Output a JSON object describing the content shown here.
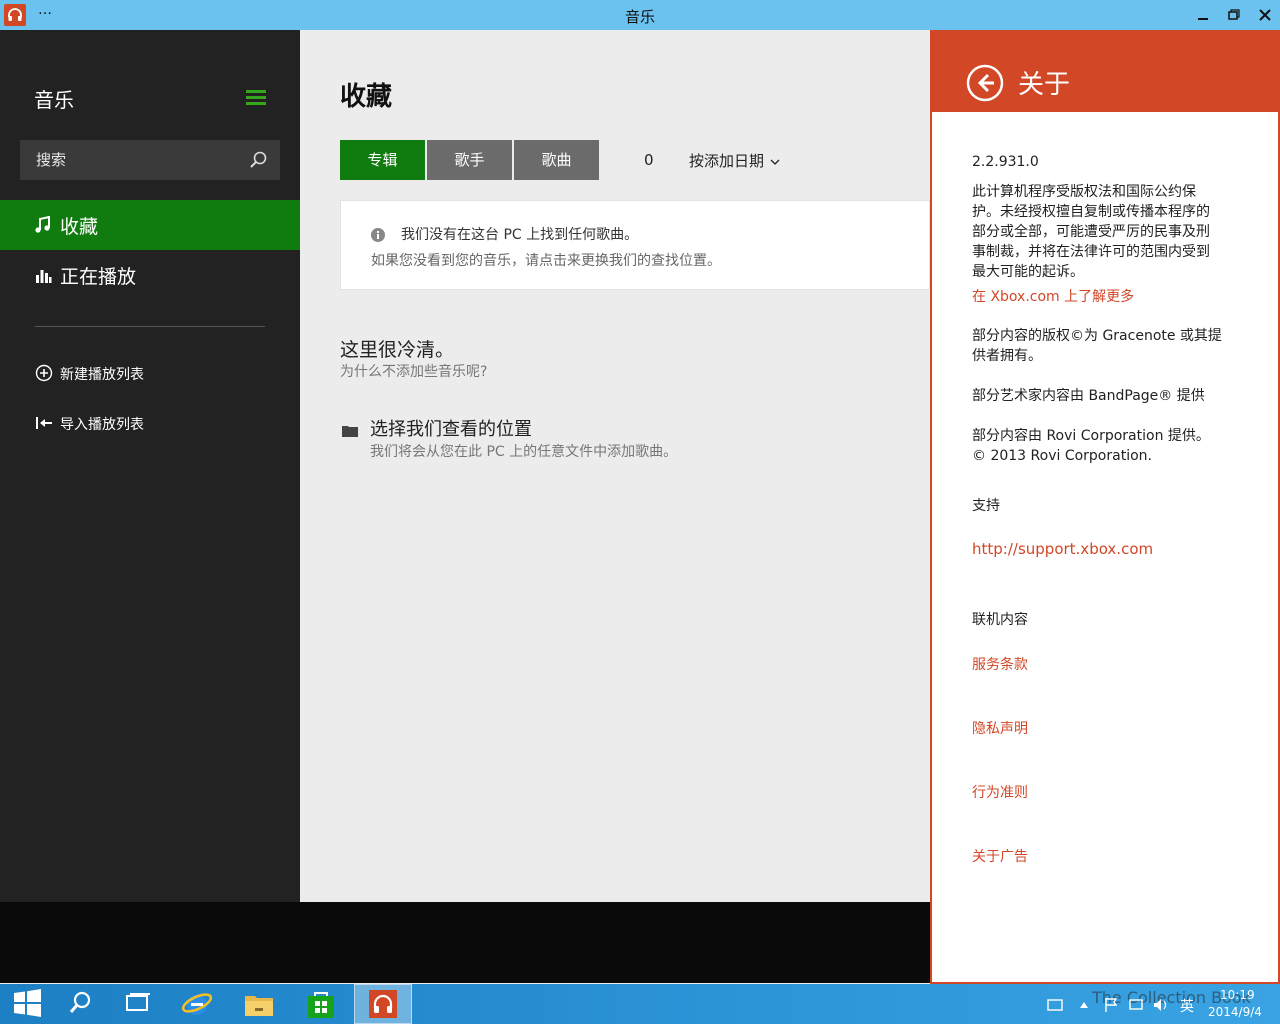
{
  "window": {
    "title": "音乐",
    "menu": "…"
  },
  "sidebar": {
    "title": "音乐",
    "search_placeholder": "搜索",
    "nav": [
      {
        "label": "收藏"
      },
      {
        "label": "正在播放"
      }
    ],
    "actions": [
      {
        "label": "新建播放列表"
      },
      {
        "label": "导入播放列表"
      }
    ]
  },
  "main": {
    "title": "收藏",
    "tabs": [
      {
        "label": "专辑"
      },
      {
        "label": "歌手"
      },
      {
        "label": "歌曲"
      }
    ],
    "count": "0",
    "sort_label": "按添加日期",
    "notice": {
      "line1": "我们没有在这台 PC 上找到任何歌曲。",
      "line2": "如果您没看到您的音乐，请点击来更换我们的查找位置。"
    },
    "empty_title": "这里很冷清。",
    "empty_subtitle": "为什么不添加些音乐呢?",
    "choose_location": "选择我们查看的位置",
    "choose_desc": "我们将会从您在此 PC 上的任意文件中添加歌曲。"
  },
  "about": {
    "title": "关于",
    "version": "2.2.931.0",
    "copyright": "此计算机程序受版权法和国际公约保护。未经授权擅自复制或传播本程序的部分或全部，可能遭受严厉的民事及刑事制裁，并将在法律许可的范围内受到最大可能的起诉。",
    "xbox_link": "在 Xbox.com 上了解更多",
    "gracenote": "部分内容的版权©为 Gracenote 或其提供者拥有。",
    "bandpage": "部分艺术家内容由 BandPage® 提供",
    "rovi": "部分内容由 Rovi Corporation 提供。© 2013 Rovi Corporation.",
    "support_label": "支持",
    "support_link": "http://support.xbox.com",
    "online_label": "联机内容",
    "links": [
      "服务条款",
      "隐私声明",
      "行为准则",
      "关于广告"
    ]
  },
  "taskbar": {
    "watermark": "The Collection Book",
    "ime": "英",
    "time": "10:19",
    "date": "2014/9/4"
  },
  "colors": {
    "accent_green": "#107c10",
    "accent_orange": "#d24726",
    "sidebar_bg": "#222222",
    "titlebar": "#6bc2ee"
  },
  "icons": [
    "headphones-icon",
    "hamburger-icon",
    "search-icon",
    "music-note-icon",
    "equalizer-icon",
    "add-circle-icon",
    "import-icon",
    "info-icon",
    "folder-icon",
    "back-arrow-icon",
    "windows-logo-icon",
    "ie-icon",
    "file-explorer-icon",
    "store-icon"
  ]
}
